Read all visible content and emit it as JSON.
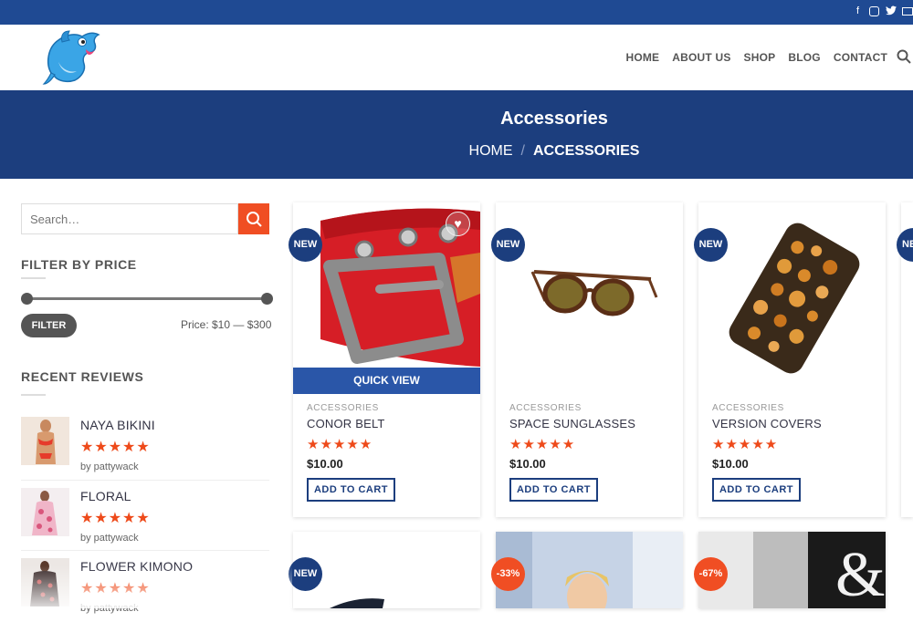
{
  "topbar": {
    "social": [
      {
        "icon": "facebook-icon",
        "glyph": "f"
      },
      {
        "icon": "instagram-icon",
        "glyph": ""
      },
      {
        "icon": "twitter-icon",
        "glyph": "🐦"
      },
      {
        "icon": "mail-icon",
        "glyph": ""
      }
    ]
  },
  "nav": [
    "HOME",
    "ABOUT US",
    "SHOP",
    "BLOG",
    "CONTACT"
  ],
  "banner": {
    "title": "Accessories",
    "crumb_home": "HOME",
    "crumb_sep": "/",
    "crumb_current": "ACCESSORIES"
  },
  "sidebar": {
    "search_placeholder": "Search…",
    "filter_heading": "FILTER BY PRICE",
    "filter_button": "FILTER",
    "price_text": "Price: $10 — $300",
    "reviews_heading": "RECENT REVIEWS",
    "reviews": [
      {
        "name": "NAYA BIKINI",
        "stars": "★★★★★",
        "by": "by pattywack"
      },
      {
        "name": "FLORAL",
        "stars": "★★★★★",
        "by": "by pattywack"
      },
      {
        "name": "FLOWER KIMONO",
        "stars": "★★★★★",
        "by": "by pattywack"
      }
    ]
  },
  "products": [
    {
      "badge": "NEW",
      "category": "ACCESSORIES",
      "name": "CONOR BELT",
      "stars": "★★★★★",
      "price": "$10.00",
      "cta": "ADD TO CART",
      "quick_view": "QUICK VIEW"
    },
    {
      "badge": "NEW",
      "category": "ACCESSORIES",
      "name": "SPACE SUNGLASSES",
      "stars": "★★★★★",
      "price": "$10.00",
      "cta": "ADD TO CART"
    },
    {
      "badge": "NEW",
      "category": "ACCESSORIES",
      "name": "VERSION COVERS",
      "stars": "★★★★★",
      "price": "$10.00",
      "cta": "ADD TO CART"
    },
    {
      "badge": "NE"
    }
  ],
  "products_row2": [
    {
      "badge": "NEW"
    },
    {
      "badge": "-33%"
    },
    {
      "badge": "-67%"
    }
  ],
  "colors": {
    "topbar": "#1f4a93",
    "banner": "#1c3e7e",
    "accent": "#f04e23",
    "stars": "#ee4a1a"
  }
}
